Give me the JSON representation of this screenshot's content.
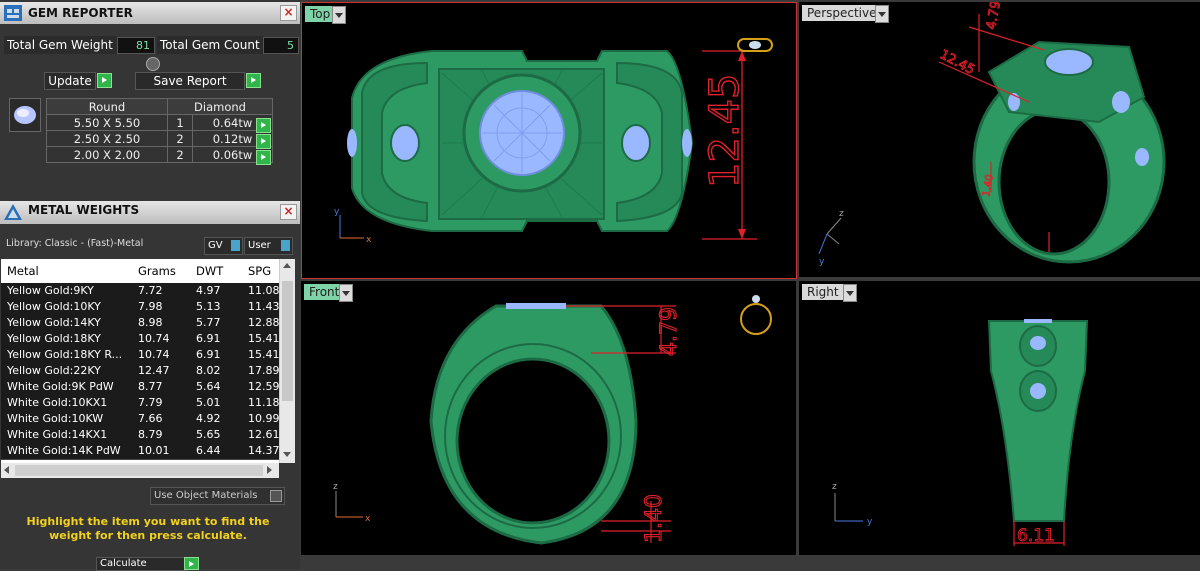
{
  "gem_reporter": {
    "title": "GEM REPORTER",
    "total_weight_label": "Total Gem Weight",
    "total_weight_value": "81",
    "total_count_label": "Total Gem Count",
    "total_count_value": "5",
    "update_label": "Update",
    "save_report_label": "Save Report",
    "shape": "Round",
    "type": "Diamond",
    "rows": [
      {
        "size": "5.50 X 5.50",
        "count": "1",
        "weight": "0.64tw"
      },
      {
        "size": "2.50 X 2.50",
        "count": "2",
        "weight": "0.12tw"
      },
      {
        "size": "2.00 X 2.00",
        "count": "2",
        "weight": "0.06tw"
      }
    ]
  },
  "metal_weights": {
    "title": "METAL WEIGHTS",
    "library": "Library: Classic - (Fast)-Metal",
    "gv_label": "GV",
    "user_label": "User",
    "columns": [
      "Metal",
      "Grams",
      "DWT",
      "SPG"
    ],
    "rows": [
      {
        "metal": "Yellow Gold:9KY",
        "grams": "7.72",
        "dwt": "4.97",
        "spg": "11.08"
      },
      {
        "metal": "Yellow Gold:10KY",
        "grams": "7.98",
        "dwt": "5.13",
        "spg": "11.43"
      },
      {
        "metal": "Yellow Gold:14KY",
        "grams": "8.98",
        "dwt": "5.77",
        "spg": "12.88"
      },
      {
        "metal": "Yellow Gold:18KY",
        "grams": "10.74",
        "dwt": "6.91",
        "spg": "15.41"
      },
      {
        "metal": "Yellow Gold:18KY R...",
        "grams": "10.74",
        "dwt": "6.91",
        "spg": "15.41"
      },
      {
        "metal": "Yellow Gold:22KY",
        "grams": "12.47",
        "dwt": "8.02",
        "spg": "17.89"
      },
      {
        "metal": "White Gold:9K PdW",
        "grams": "8.77",
        "dwt": "5.64",
        "spg": "12.59"
      },
      {
        "metal": "White Gold:10KX1",
        "grams": "7.79",
        "dwt": "5.01",
        "spg": "11.18"
      },
      {
        "metal": "White Gold:10KW",
        "grams": "7.66",
        "dwt": "4.92",
        "spg": "10.99"
      },
      {
        "metal": "White Gold:14KX1",
        "grams": "8.79",
        "dwt": "5.65",
        "spg": "12.61"
      },
      {
        "metal": "White Gold:14K PdW",
        "grams": "10.01",
        "dwt": "6.44",
        "spg": "14.37"
      }
    ],
    "use_object_materials": "Use Object Materials",
    "hint": "Highlight the item you want to find the weight for then press calculate.",
    "calculate_label": "Calculate"
  },
  "viewports": {
    "top": {
      "label": "Top",
      "dim": "12.45"
    },
    "perspective": {
      "label": "Perspective",
      "dim_a": "12.45",
      "dim_b": "4.79",
      "dim_c": "1.40"
    },
    "front": {
      "label": "Front",
      "dim_a": "4.79",
      "dim_b": "1.40"
    },
    "right": {
      "label": "Right",
      "dim": "6.11"
    }
  },
  "axes": {
    "x": "x",
    "y": "y",
    "z": "z"
  },
  "colors": {
    "metal": "#2e9a63",
    "metal_dark": "#1c6b44",
    "gem": "#9ab8ff",
    "dimension": "#e0202a"
  }
}
